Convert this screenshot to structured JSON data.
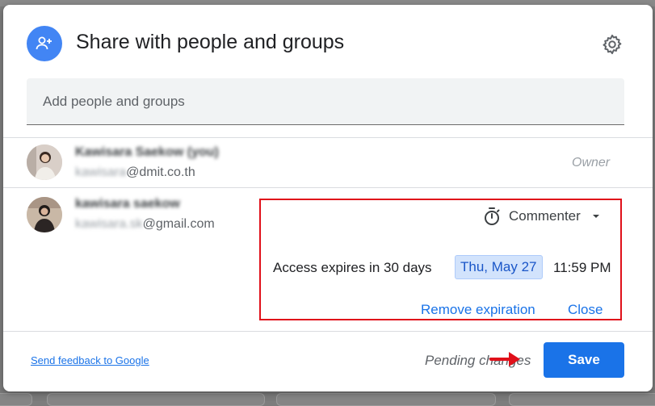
{
  "dialog": {
    "title": "Share with people and groups",
    "add_placeholder": "Add people and groups"
  },
  "people": [
    {
      "name": "Kawisara Saekow (you)",
      "email_blurred": "kawisara",
      "email_visible": "@dmit.co.th",
      "role": "Owner"
    },
    {
      "name": "kawisara saekow",
      "email_blurred": "kawisara.sk",
      "email_visible": "@gmail.com",
      "role": "Commenter",
      "access_expires": "Access expires in 30 days",
      "expiry_date": "Thu, May 27",
      "expiry_time": "11:59 PM",
      "remove_expiration": "Remove expiration",
      "close": "Close"
    }
  ],
  "footer": {
    "feedback_link": "Send feedback to Google",
    "pending": "Pending changes",
    "save": "Save"
  },
  "colors": {
    "accent": "#1a73e8",
    "highlight_box": "#e0101a",
    "date_chip_bg": "#d2e3fc",
    "arrow": "#e0101a"
  },
  "icons": {
    "header": "add-person-icon",
    "settings": "gear-icon",
    "timer": "timer-icon",
    "dropdown": "caret-down-icon",
    "annotation": "red-arrow-icon"
  }
}
